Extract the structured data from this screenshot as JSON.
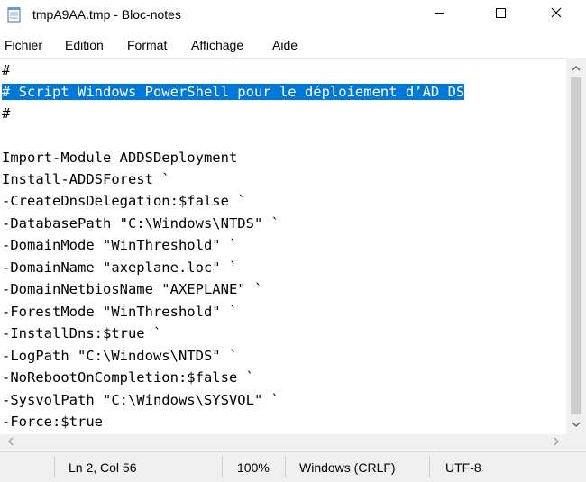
{
  "window": {
    "title": "tmpA9AA.tmp - Bloc-notes",
    "icon": "notepad-icon",
    "controls": [
      "minimize-icon",
      "maximize-icon",
      "close-icon"
    ]
  },
  "menu": [
    "Fichier",
    "Edition",
    "Format",
    "Affichage",
    "Aide"
  ],
  "editor": {
    "lines": [
      "#",
      "# Script Windows PowerShell pour le déploiement d’AD DS",
      "#",
      "",
      "Import-Module ADDSDeployment",
      "Install-ADDSForest `",
      "-CreateDnsDelegation:$false `",
      "-DatabasePath \"C:\\Windows\\NTDS\" `",
      "-DomainMode \"WinThreshold\" `",
      "-DomainName \"axeplane.loc\" `",
      "-DomainNetbiosName \"AXEPLANE\" `",
      "-ForestMode \"WinThreshold\" `",
      "-InstallDns:$true `",
      "-LogPath \"C:\\Windows\\NTDS\" `",
      "-NoRebootOnCompletion:$false `",
      "-SysvolPath \"C:\\Windows\\SYSVOL\" `",
      "-Force:$true"
    ],
    "selected_line_index": 1,
    "selection_color": "#0078d7"
  },
  "status": {
    "position": "Ln 2, Col 56",
    "zoom": "100%",
    "line_ending": "Windows (CRLF)",
    "encoding": "UTF-8"
  }
}
